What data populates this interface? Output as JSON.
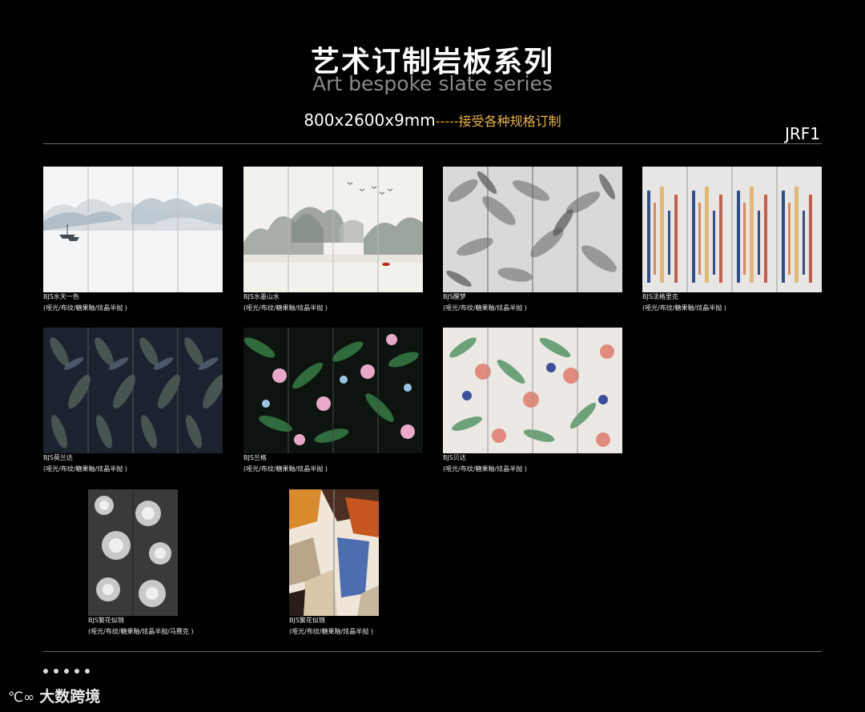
{
  "header": {
    "title_cn": "艺术订制岩板系列",
    "title_en": "Art bespoke slate series",
    "size": "800x2600x9mm",
    "dashes": "-----",
    "note": "接受各种规格订制",
    "code": "JRF1"
  },
  "finish": "(哑光/布纹/糖果釉/炫晶半抛 )",
  "products": [
    {
      "name": "BJS水天一色",
      "finish": "(哑光/布纹/糖果釉/炫晶半抛 )",
      "pattern": "ink-landscape"
    },
    {
      "name": "BJS水墨山水",
      "finish": "(哑光/布纹/糖果釉/炫晶半抛 )",
      "pattern": "ink-mountains"
    },
    {
      "name": "BJS醒梦",
      "finish": "(哑光/布纹/糖果釉/炫晶半抛 )",
      "pattern": "grey-leaves"
    },
    {
      "name": "BJS法格里克",
      "finish": "(哑光/布纹/糖果釉/炫晶半抛 )",
      "pattern": "color-drips"
    },
    {
      "name": "BJS莫兰达",
      "finish": "(哑光/布纹/糖果釉/炫晶半抛 )",
      "pattern": "dark-leaves"
    },
    {
      "name": "BJS兰格",
      "finish": "(哑光/布纹/糖果釉/炫晶半抛 )",
      "pattern": "dark-tropical"
    },
    {
      "name": "BJS贝达",
      "finish": "(哑光/布纹/糖果釉/炫晶半抛 )",
      "pattern": "light-tropical"
    },
    {
      "name": "BJS繁花似锦",
      "finish": "(哑光/布纹/糖果釉/炫晶半抛/马赛克 )",
      "pattern": "grey-flowers"
    },
    {
      "name": "BJS繁花似锦",
      "finish": "(哑光/布纹/糖果釉/炫晶半抛 )",
      "pattern": "abstract-shapes"
    }
  ],
  "watermark": {
    "logo": "℃∞",
    "text": "大数跨境"
  },
  "colors": {
    "background": "#000000",
    "accent": "#e8b446",
    "subtitle": "#8a8a8a"
  }
}
